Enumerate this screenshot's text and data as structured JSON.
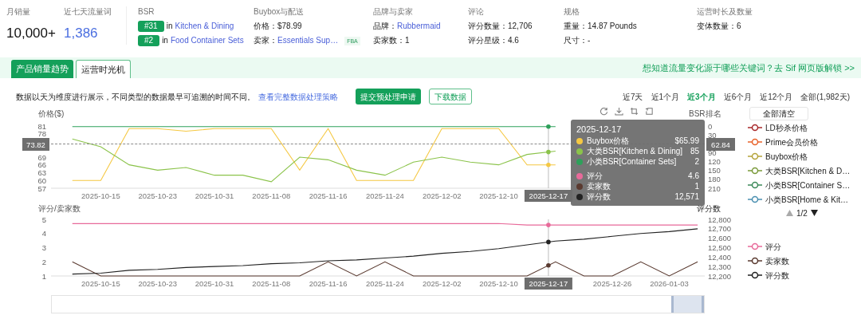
{
  "header": {
    "metrics": [
      {
        "label": "月销量",
        "value": "10,000+",
        "kind": "plain"
      },
      {
        "label": "近七天流量词",
        "value": "1,386",
        "kind": "link"
      }
    ],
    "bsr": {
      "label": "BSR",
      "ranks": [
        {
          "rank": "#31",
          "prep": "in",
          "category": "Kitchen & Dining"
        },
        {
          "rank": "#2",
          "prep": "in",
          "category": "Food Container Sets"
        }
      ]
    },
    "sections": [
      {
        "title": "Buybox与配送",
        "lines": [
          {
            "label": "价格：",
            "value": "$78.99",
            "kind": "text"
          },
          {
            "label": "卖家：",
            "value": "Essentials Sup…",
            "kind": "link",
            "badge": "FBA"
          }
        ]
      },
      {
        "title": "品牌与卖家",
        "lines": [
          {
            "label": "品牌：",
            "value": "Rubbermaid",
            "kind": "link"
          },
          {
            "label": "卖家数：",
            "value": "1",
            "kind": "text"
          }
        ]
      },
      {
        "title": "评论",
        "lines": [
          {
            "label": "评分数量：",
            "value": "12,706",
            "kind": "text"
          },
          {
            "label": "评分星级：",
            "value": "4.6",
            "kind": "text"
          }
        ]
      },
      {
        "title": "规格",
        "lines": [
          {
            "label": "重量：",
            "value": "14.87 Pounds",
            "kind": "text"
          },
          {
            "label": "尺寸：",
            "value": "-",
            "kind": "text"
          }
        ]
      },
      {
        "title": "运营时长及数量",
        "lines": [
          {
            "label": "变体数量：",
            "value": "6",
            "kind": "text"
          }
        ]
      }
    ]
  },
  "tabs": [
    {
      "label": "产品销量趋势",
      "selected": true
    },
    {
      "label": "运营时光机",
      "selected": false
    }
  ],
  "promo_link": "想知道流量变化源于哪些关键词？去 Sif 网页版解锁 >>",
  "notice": {
    "text": "数据以天为维度进行展示，不同类型的数据最早可追溯的时间不同。",
    "link": "查看完整数据处理策略"
  },
  "buttons": [
    {
      "label": "提交预处理申请",
      "kind": "primary"
    },
    {
      "label": "下载数据",
      "kind": "outline"
    }
  ],
  "ranges": [
    {
      "label": "近7天",
      "selected": false
    },
    {
      "label": "近1个月",
      "selected": false
    },
    {
      "label": "近3个月",
      "selected": true
    },
    {
      "label": "近6个月",
      "selected": false
    },
    {
      "label": "近12个月",
      "selected": false
    },
    {
      "label": "全部(1,982天)",
      "selected": false
    }
  ],
  "price_chart": {
    "chart_data": {
      "type": "line",
      "ylabel": "价格($)",
      "y2label": "BSR排名",
      "categories": [
        null,
        "2025-10-15",
        null,
        "2025-10-23",
        null,
        "2025-10-31",
        null,
        "2025-11-08",
        null,
        "2025-11-16",
        null,
        "2025-11-24",
        null,
        "2025-12-02",
        null,
        "2025-12-10",
        null,
        null,
        null,
        null,
        null,
        null,
        null
      ],
      "ylim": [
        57,
        81
      ],
      "y2lim": [
        210,
        0
      ],
      "yticks": [
        57,
        60,
        63,
        66,
        69,
        78,
        81
      ],
      "y2ticks": [
        0,
        30,
        90,
        120,
        150,
        180,
        210
      ],
      "series": [
        {
          "name": "Buybox价格",
          "color": "#f5c842",
          "values": [
            60,
            60,
            80,
            80,
            79,
            80,
            80,
            80,
            64,
            80,
            60,
            60,
            60,
            80,
            80,
            80,
            66,
            66,
            null,
            null,
            null,
            null,
            null
          ]
        },
        {
          "name": "大类BSR[Kitchen & Dining]",
          "color": "#8bc34a",
          "axis": "y2",
          "values": [
            44,
            70,
            131,
            149,
            140,
            166,
            166,
            188,
            105,
            114,
            149,
            166,
            122,
            105,
            122,
            131,
            96,
            85,
            null,
            null,
            null,
            null,
            null
          ]
        },
        {
          "name": "小类BSR[Container Sets]",
          "color": "#2ea05a",
          "axis": "y2",
          "values": [
            2,
            2,
            2,
            2,
            2,
            2,
            2,
            2,
            2,
            2,
            2,
            2,
            2,
            2,
            2,
            2,
            2,
            2,
            null,
            null,
            null,
            null,
            null
          ]
        }
      ],
      "annotations": [
        "2025-12-17",
        "73.82",
        "62.84"
      ]
    }
  },
  "rating_chart": {
    "chart_data": {
      "type": "line",
      "ylabel": "评分/卖家数",
      "y2label": "评分数",
      "categories": [
        null,
        "2025-10-15",
        null,
        "2025-10-23",
        null,
        "2025-10-31",
        null,
        "2025-11-08",
        null,
        "2025-11-16",
        null,
        "2025-11-24",
        null,
        "2025-12-02",
        null,
        "2025-12-10",
        null,
        null,
        null,
        "2025-12-26",
        null,
        "2026-01-03",
        null
      ],
      "ylim": [
        1,
        5
      ],
      "y2lim": [
        12200,
        12800
      ],
      "yticks": [
        1,
        2,
        3,
        4,
        5
      ],
      "y2ticks": [
        {
          "value": 12200,
          "label": "12,200"
        },
        {
          "value": 12300,
          "label": "12,300"
        },
        {
          "value": 12400,
          "label": "12,400"
        },
        {
          "value": 12500,
          "label": "12,500"
        },
        {
          "value": 12600,
          "label": "12,600"
        },
        {
          "value": 12700,
          "label": "12,700"
        },
        {
          "value": 12800,
          "label": "12,800"
        }
      ],
      "series": [
        {
          "name": "评分",
          "color": "#e86a9a",
          "values": [
            4.7,
            4.7,
            4.7,
            4.7,
            4.7,
            4.7,
            4.7,
            4.7,
            4.7,
            4.7,
            4.7,
            4.7,
            4.7,
            4.7,
            4.7,
            4.7,
            4.6,
            4.6,
            4.6,
            4.6,
            4.6,
            4.6,
            4.6
          ]
        },
        {
          "name": "卖家数",
          "color": "#5a3a30",
          "values": [
            2,
            1,
            1,
            1,
            1,
            1,
            1,
            1,
            1,
            2,
            1,
            2,
            1,
            1,
            1,
            1,
            1,
            2,
            1,
            1,
            2,
            1,
            2
          ]
        },
        {
          "name": "评分数",
          "color": "#222222",
          "axis": "y2",
          "values": [
            12220,
            12230,
            12260,
            12270,
            12290,
            12300,
            12310,
            12330,
            12340,
            12360,
            12370,
            12390,
            12410,
            12440,
            12460,
            12490,
            12530,
            12570,
            12590,
            12620,
            12650,
            12670,
            12700
          ]
        }
      ],
      "annotations": [
        "2025-12-17"
      ]
    }
  },
  "tooltip": {
    "date": "2025-12-17",
    "values": [
      [
        "$65.99",
        "85",
        "2"
      ],
      [
        "4.6",
        "1",
        "12,571"
      ]
    ]
  },
  "zoom_slider": {
    "level": 0.05
  },
  "legend": {
    "clear_button": "全部清空",
    "items": [
      {
        "label": "LD秒杀价格",
        "color": "#a8282a"
      },
      {
        "label": "Prime会员价格",
        "color": "#e8632b"
      },
      {
        "label": "Buybox价格",
        "color": "#b5a33a"
      },
      {
        "label": "大类BSR[Kitchen & D…",
        "color": "#7a9a3a"
      },
      {
        "label": "小类BSR[Container S…",
        "color": "#3d8a5a"
      },
      {
        "label": "小类BSR[Home & Kit…",
        "color": "#4a8fb0"
      }
    ],
    "pager": "1/2",
    "bottom_items": [
      {
        "label": "评分",
        "color": "#e86a9a"
      },
      {
        "label": "卖家数",
        "color": "#5a3a30"
      },
      {
        "label": "评分数",
        "color": "#222222"
      }
    ]
  }
}
